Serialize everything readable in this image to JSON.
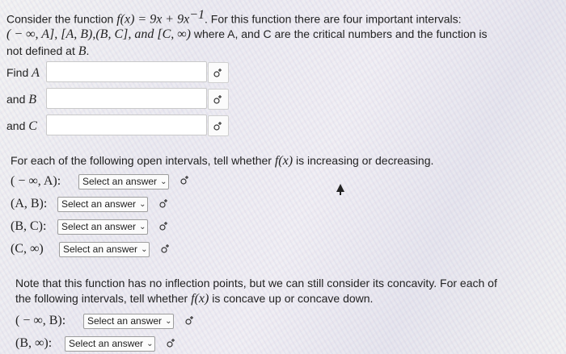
{
  "intro": {
    "line1_pre": "Consider the function ",
    "func": "f(x) = 9x + 9x",
    "exp": "−1",
    "line1_post": ". For this function there are four important intervals:",
    "intervals": "( − ∞, A], [A, B),(B, C], and [C, ∞)",
    "line2_post": " where A, and C are the critical numbers and the function is",
    "line3_pre": "not defined at ",
    "line3_var": "B",
    "line3_end": "."
  },
  "fields": [
    {
      "prefix": "Find ",
      "var": "A",
      "value": ""
    },
    {
      "prefix": "and ",
      "var": "B",
      "value": ""
    },
    {
      "prefix": "and ",
      "var": "C",
      "value": ""
    }
  ],
  "section2": {
    "text_pre": "For each of the following open intervals, tell whether ",
    "func": "f(x)",
    "text_post": " is increasing or decreasing.",
    "rows": [
      {
        "label": "( − ∞, A):",
        "select": "Select an answer"
      },
      {
        "label": "(A, B):",
        "select": "Select an answer"
      },
      {
        "label": "(B, C):",
        "select": "Select an answer"
      },
      {
        "label": "(C, ∞)",
        "select": "Select an answer"
      }
    ]
  },
  "section3": {
    "line1": "Note that this function has no inflection points, but we can still consider its concavity. For each of",
    "line2_pre": "the following intervals, tell whether ",
    "func": "f(x)",
    "line2_post": " is concave up or concave down.",
    "rows": [
      {
        "label": "( − ∞, B):",
        "select": "Select an answer"
      },
      {
        "label": "(B, ∞):",
        "select": "Select an answer"
      }
    ]
  },
  "icons": {
    "help": "sigma-help-icon",
    "chevron": "chevron-down-icon",
    "cursor": "cursor-icon"
  }
}
